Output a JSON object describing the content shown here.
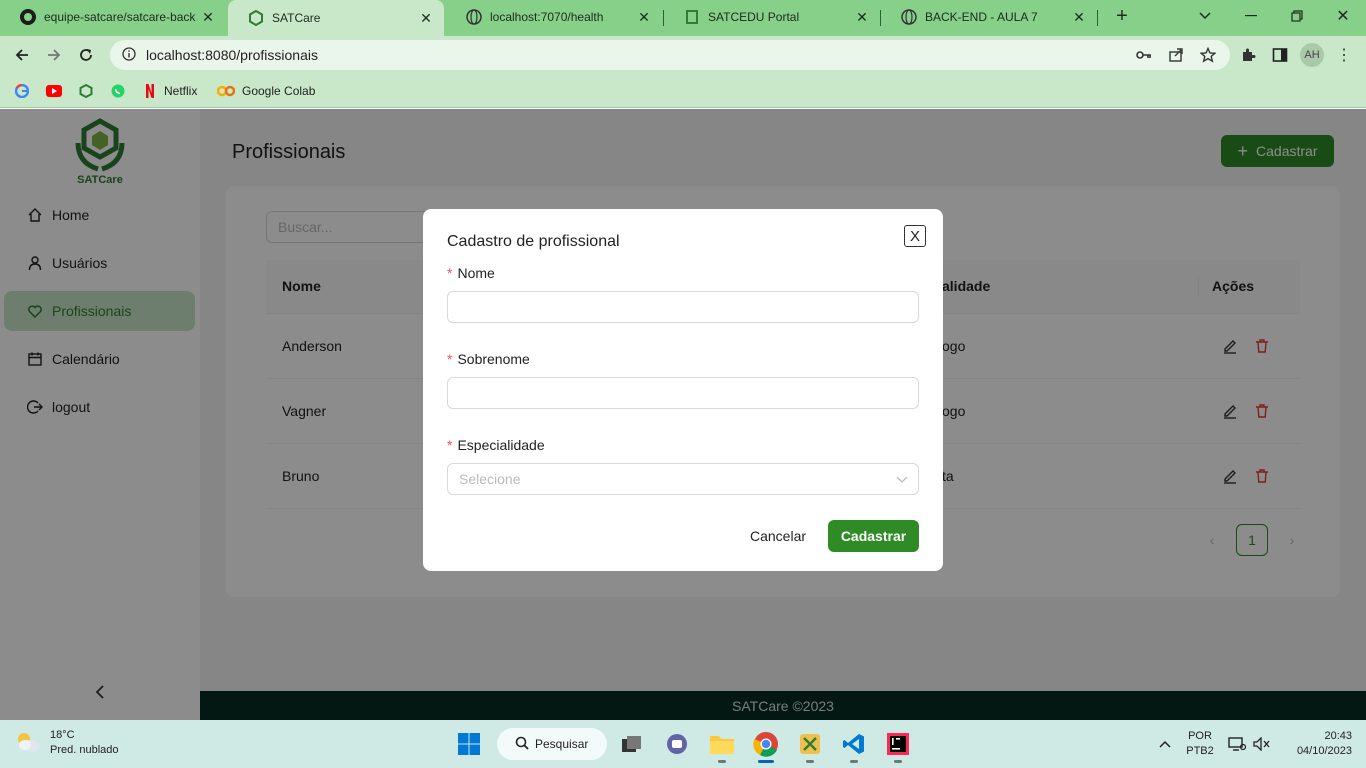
{
  "browser": {
    "tabs": [
      {
        "title": "equipe-satcare/satcare-back",
        "active": false
      },
      {
        "title": "SATCare",
        "active": true
      },
      {
        "title": "localhost:7070/health",
        "active": false
      },
      {
        "title": "SATCEDU Portal",
        "active": false
      },
      {
        "title": "BACK-END - AULA 7",
        "active": false
      }
    ],
    "url": "localhost:8080/profissionais",
    "profile_initials": "AH",
    "bookmarks": [
      {
        "label": "",
        "icon": "google-icon"
      },
      {
        "label": "",
        "icon": "youtube-icon"
      },
      {
        "label": "",
        "icon": "satcare-icon"
      },
      {
        "label": "",
        "icon": "whatsapp-icon"
      },
      {
        "label": "Netflix",
        "icon": "netflix-icon"
      },
      {
        "label": "Google Colab",
        "icon": "colab-icon"
      }
    ]
  },
  "app": {
    "logo_text": "SATCare",
    "menu": [
      {
        "label": "Home",
        "icon": "home-icon",
        "selected": false
      },
      {
        "label": "Usuários",
        "icon": "user-icon",
        "selected": false
      },
      {
        "label": "Profissionais",
        "icon": "heart-icon",
        "selected": true
      },
      {
        "label": "Calendário",
        "icon": "calendar-icon",
        "selected": false
      },
      {
        "label": "logout",
        "icon": "logout-icon",
        "selected": false
      }
    ],
    "page_title": "Profissionais",
    "add_button": "Cadastrar",
    "search_placeholder": "Buscar...",
    "table": {
      "columns": [
        "Nome",
        "alidade",
        "Ações"
      ],
      "rows": [
        {
          "nome": "Anderson",
          "especialidade": "ogo"
        },
        {
          "nome": "Vagner",
          "especialidade": "ogo"
        },
        {
          "nome": "Bruno",
          "especialidade": "ta"
        }
      ]
    },
    "pagination": {
      "current": "1"
    },
    "footer": "SATCare ©2023"
  },
  "modal": {
    "title": "Cadastro de profissional",
    "close_label": "X",
    "fields": [
      {
        "label": "Nome",
        "required": "*",
        "value": ""
      },
      {
        "label": "Sobrenome",
        "required": "*",
        "value": ""
      },
      {
        "label": "Especialidade",
        "required": "*",
        "placeholder": "Selecione"
      }
    ],
    "cancel": "Cancelar",
    "submit": "Cadastrar"
  },
  "taskbar": {
    "weather_temp": "18°C",
    "weather_desc": "Pred. nublado",
    "search_label": "Pesquisar",
    "lang": "POR",
    "layout": "PTB2",
    "time": "20:43",
    "date": "04/10/2023"
  },
  "colors": {
    "primary": "#2e8b25",
    "chrome_frame": "#87d08a",
    "footer": "#072d23"
  }
}
